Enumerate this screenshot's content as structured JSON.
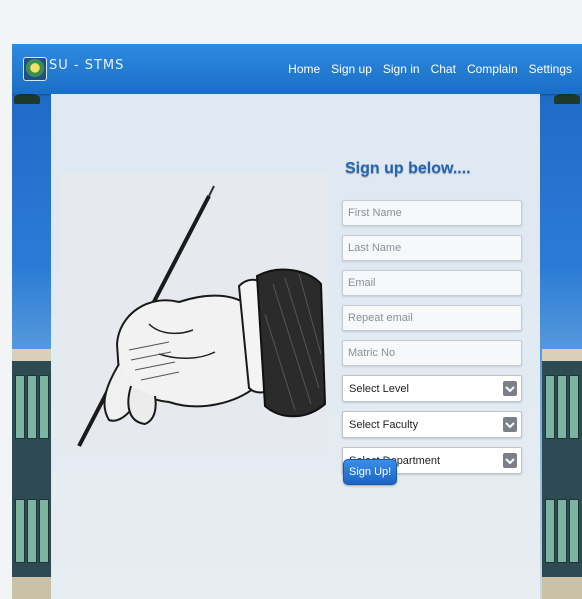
{
  "header": {
    "brand": "SU - STMS",
    "nav": [
      "Home",
      "Sign up",
      "Sign in",
      "Chat",
      "Complain",
      "Settings"
    ]
  },
  "form": {
    "title": "Sign up below....",
    "fields": [
      {
        "placeholder": "First Name",
        "value": ""
      },
      {
        "placeholder": "Last Name",
        "value": ""
      },
      {
        "placeholder": "Email",
        "value": ""
      },
      {
        "placeholder": "Repeat email",
        "value": ""
      },
      {
        "placeholder": "Matric No",
        "value": ""
      }
    ],
    "selects": [
      {
        "label": "Select Level"
      },
      {
        "label": "Select Faculty"
      },
      {
        "label": "Select Department"
      }
    ],
    "submit_label": "Sign Up!"
  },
  "icons": {
    "logo": "school-crest-icon",
    "dropdown": "chevron-down-icon",
    "illustration": "hand-with-pen-icon"
  },
  "colors": {
    "navbar": "#1b6ec6",
    "title": "#2266bb",
    "button": "#1c64c4"
  }
}
